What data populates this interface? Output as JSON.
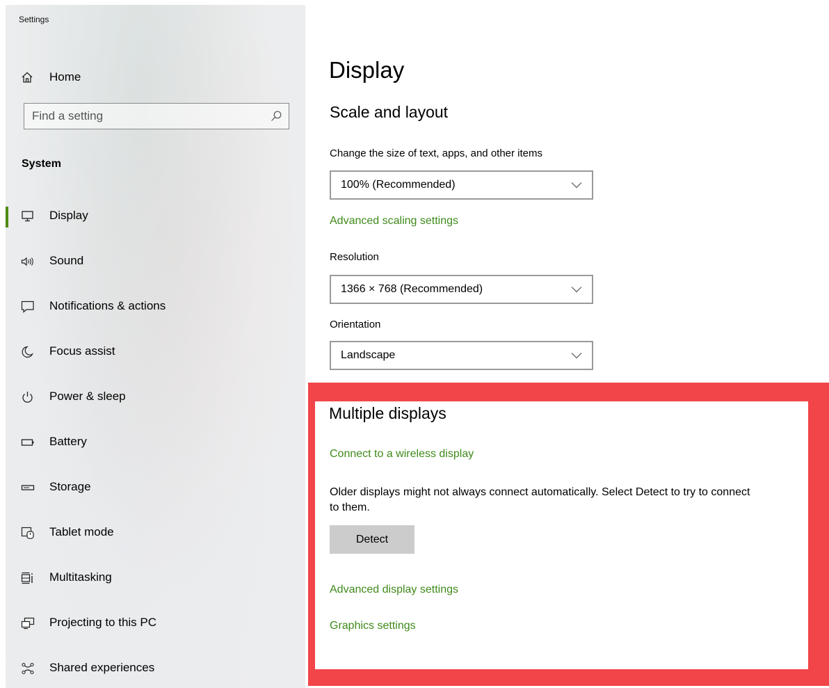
{
  "window": {
    "title": "Settings"
  },
  "sidebar": {
    "home_label": "Home",
    "search_placeholder": "Find a setting",
    "section_heading": "System",
    "items": [
      {
        "label": "Display",
        "icon": "monitor-icon",
        "active": true
      },
      {
        "label": "Sound",
        "icon": "speaker-icon"
      },
      {
        "label": "Notifications & actions",
        "icon": "notification-icon"
      },
      {
        "label": "Focus assist",
        "icon": "moon-icon"
      },
      {
        "label": "Power & sleep",
        "icon": "power-icon"
      },
      {
        "label": "Battery",
        "icon": "battery-icon"
      },
      {
        "label": "Storage",
        "icon": "storage-icon"
      },
      {
        "label": "Tablet mode",
        "icon": "tablet-mode-icon"
      },
      {
        "label": "Multitasking",
        "icon": "multitasking-icon"
      },
      {
        "label": "Projecting to this PC",
        "icon": "projecting-icon"
      },
      {
        "label": "Shared experiences",
        "icon": "shared-experiences-icon"
      }
    ]
  },
  "main": {
    "title": "Display",
    "scale_section": {
      "heading": "Scale and layout",
      "size_label": "Change the size of text, apps, and other items",
      "size_value": "100% (Recommended)",
      "advanced_scaling_link": "Advanced scaling settings",
      "resolution_label": "Resolution",
      "resolution_value": "1366 × 768 (Recommended)",
      "orientation_label": "Orientation",
      "orientation_value": "Landscape"
    },
    "multiple_displays": {
      "heading": "Multiple displays",
      "wireless_link": "Connect to a wireless display",
      "description": "Older displays might not always connect automatically. Select Detect to try to connect to them.",
      "detect_button": "Detect",
      "advanced_display_link": "Advanced display settings",
      "graphics_link": "Graphics settings"
    }
  },
  "colors": {
    "accent_green": "#4f8a10",
    "link_green": "#3f8a1a",
    "highlight_red": "#f2454a",
    "detect_button_bg": "#cccccc"
  }
}
